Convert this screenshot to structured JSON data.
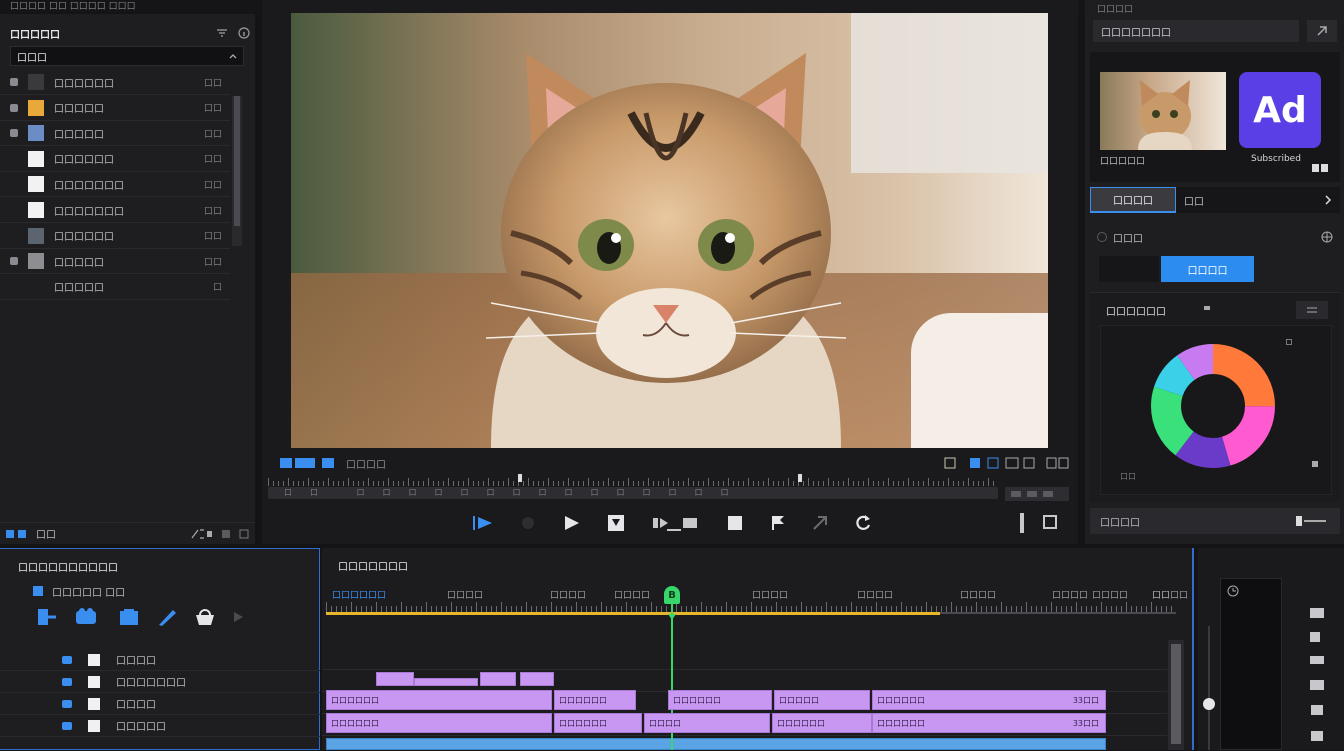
{
  "top_bar": {
    "title": "口口口口 口口 口口口口 口口口"
  },
  "library": {
    "title": "口口口口口",
    "search_value": "口口口",
    "items": [
      {
        "label": "口口口口口口",
        "meta": "口口",
        "thumb": "#3a3a3d"
      },
      {
        "label": "口口口口口",
        "meta": "口口",
        "thumb": "#e8a83a"
      },
      {
        "label": "口口口口口",
        "meta": "口口",
        "thumb": "#6b8cc4"
      },
      {
        "label": "口口口口口口",
        "meta": "口口",
        "thumb": "#f2f2f2"
      },
      {
        "label": "口口口口口口口",
        "meta": "口口",
        "thumb": "#f2f2f2"
      },
      {
        "label": "口口口口口口口",
        "meta": "口口",
        "thumb": "#f2f2f2"
      },
      {
        "label": "口口口口口口",
        "meta": "口口",
        "thumb": "#5c6470"
      },
      {
        "label": "口口口口口",
        "meta": "口口",
        "thumb": "#8e8e92"
      },
      {
        "label": "口口口口口",
        "meta": "口",
        "thumb": ""
      }
    ],
    "footer_label": "口口"
  },
  "preview": {
    "label": "口口口口",
    "ruler_text": "口口 口口口口口口口口口口口口口口口"
  },
  "inspector": {
    "header_label": "口口口口",
    "search_value": "口口口口口口口",
    "thumb_label": "口口口口口",
    "logo_text": "Ad",
    "logo_caption": "Subscribed",
    "tab_active": "口口口口",
    "tab_inactive": "口口",
    "option_label": "口口口",
    "apply_button": "口口口口",
    "color_section_title": "口口口口口口",
    "color_bottom_label": "口口",
    "footer_button": "口口口口"
  },
  "timeline_left": {
    "title": "口口口口口口口口口口",
    "toolbar_label": "口口口口口 口口",
    "tracks": [
      {
        "label": "口口口口",
        "sub": ""
      },
      {
        "label": "口口口口口口口",
        "sub": ""
      },
      {
        "label": "口口口口",
        "sub": ""
      },
      {
        "label": "口口口口口",
        "sub": ""
      }
    ]
  },
  "timeline": {
    "title": "口口口口口口口",
    "ruler_labels": [
      "口口口口口口",
      "口口口口",
      "口口口口",
      "口口口口",
      "口口口口",
      "口口口口",
      "口口口口",
      "口口口口",
      "口口口口",
      "口口口口",
      "口口"
    ],
    "playhead_label": "B",
    "clip_labels": [
      "口口口口口口",
      "口口口口口口",
      "口口口口口口",
      "口口口口口",
      "口口口口口口",
      "口口口口口口",
      "口口口口口口",
      "口口口口"
    ],
    "clip_end_labels": [
      "33口口",
      "33口口"
    ]
  },
  "colors": {
    "accent": "#2d8cf0",
    "clip_purple": "#c897f2",
    "clip_blue": "#5aa4e6",
    "playhead": "#37d66a",
    "work_area": "#e7b62b"
  }
}
